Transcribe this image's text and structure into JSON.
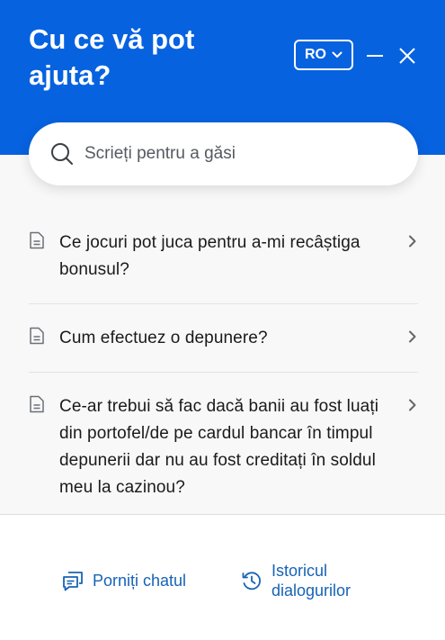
{
  "header": {
    "title": "Cu ce vă pot ajuta?",
    "language": "RO",
    "bg_color": "#0762e0"
  },
  "search": {
    "placeholder": "Scrieți pentru a găsi",
    "icon": "search-icon"
  },
  "faq": [
    {
      "text": "Ce jocuri pot juca pentru a-mi recâștiga bonusul?",
      "icon": "document-icon"
    },
    {
      "text": "Cum efectuez o depunere?",
      "icon": "document-icon"
    },
    {
      "text": "Ce-ar trebui să fac dacă banii au fost luați din portofel/de pe cardul bancar în timpul depunerii dar nu au fost creditați în soldul meu la cazinou?",
      "icon": "document-icon"
    }
  ],
  "footer": {
    "start_chat": "Porniți chatul",
    "history_line1": "Istoricul",
    "history_line2": "dialogurilor",
    "link_color": "#1763b5"
  }
}
